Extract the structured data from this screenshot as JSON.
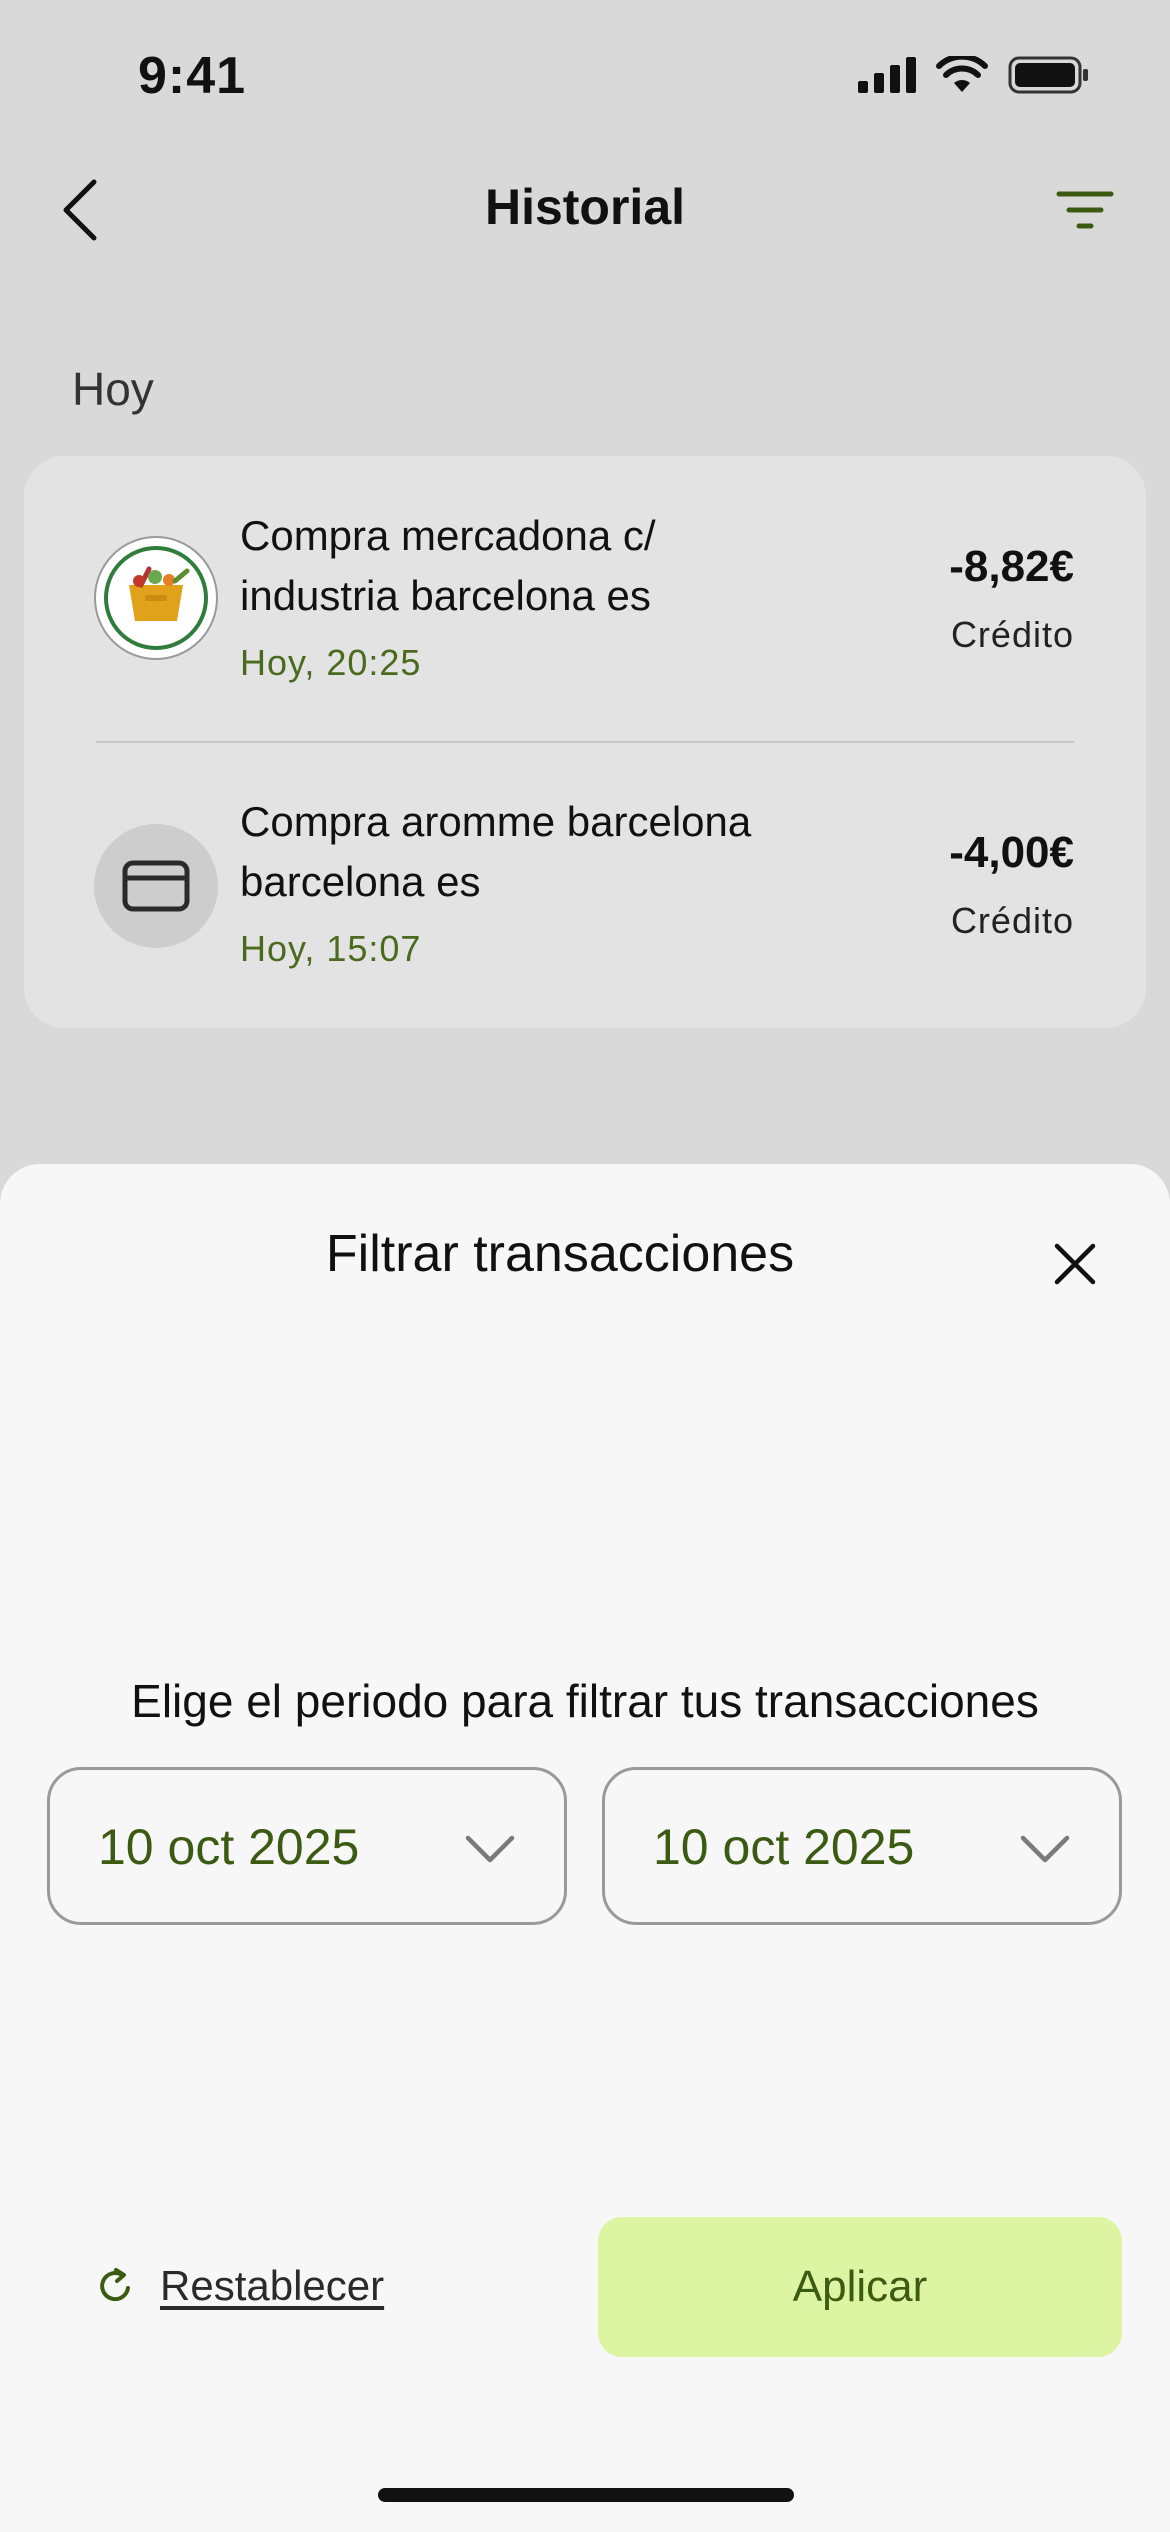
{
  "status_bar": {
    "time": "9:41"
  },
  "header": {
    "title": "Historial"
  },
  "section": {
    "label": "Hoy"
  },
  "transactions": [
    {
      "name": "Compra mercadona c/ industria barcelona es",
      "date": "Hoy, 20:25",
      "amount": "-8,82€",
      "type": "Crédito",
      "icon": "grocery-basket-icon"
    },
    {
      "name": "Compra aromme barcelona barcelona es",
      "date": "Hoy, 15:07",
      "amount": "-4,00€",
      "type": "Crédito",
      "icon": "credit-card-icon"
    }
  ],
  "filter_sheet": {
    "title": "Filtrar transacciones",
    "period_label": "Elige el periodo para filtrar tus transacciones",
    "from_date": "10 oct 2025",
    "to_date": "10 oct 2025",
    "reset_label": "Restablecer",
    "apply_label": "Aplicar"
  },
  "colors": {
    "accent": "#4a6a1e",
    "apply_bg": "#ddf4a2",
    "sheet_bg": "#f7f7f7"
  }
}
